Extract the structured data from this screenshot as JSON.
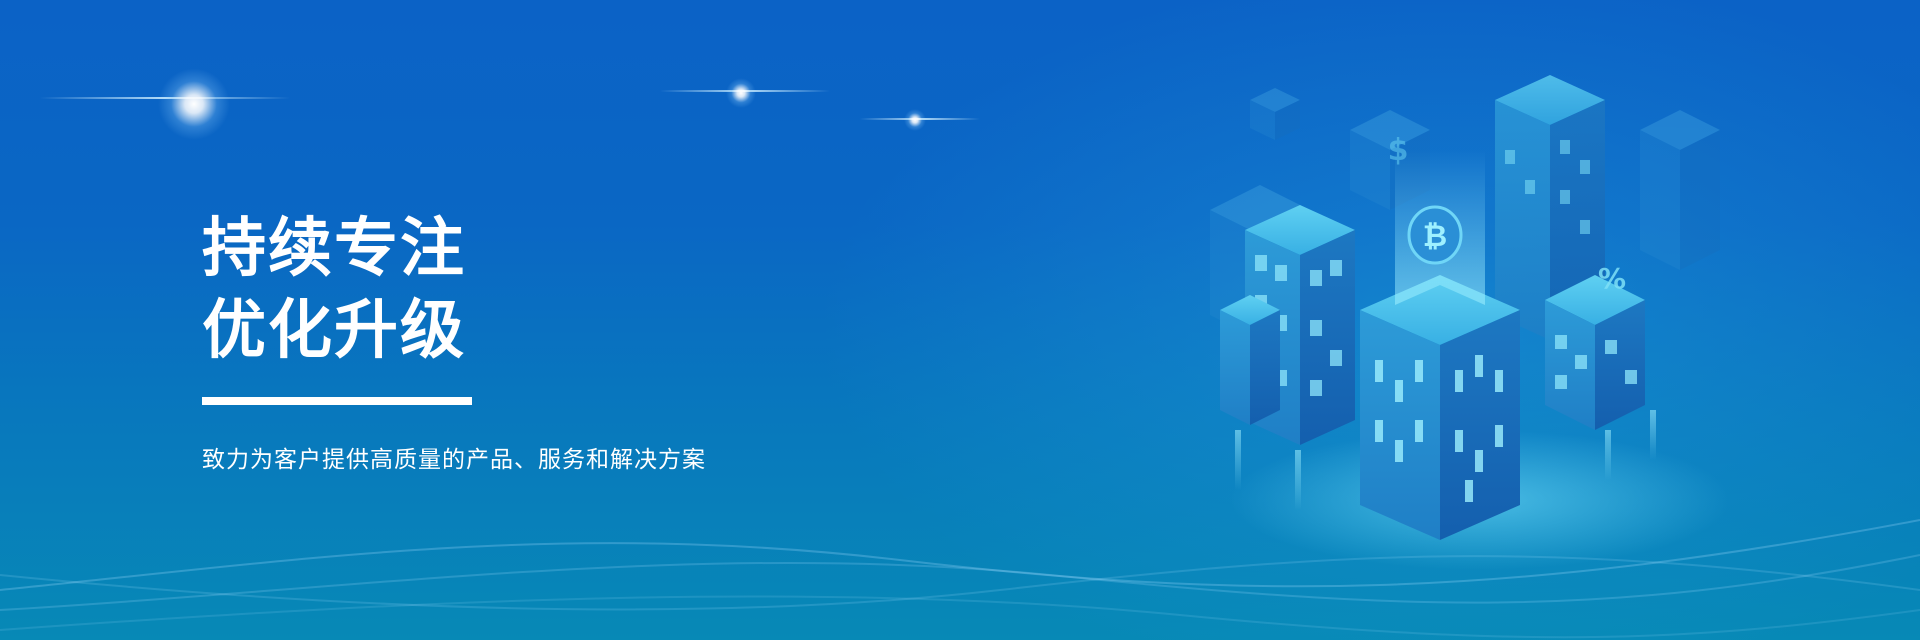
{
  "banner": {
    "headline_line1": "持续专注",
    "headline_line2": "优化升级",
    "subtitle": "致力为客户提供高质量的产品、服务和解决方案"
  },
  "illustration": {
    "icons": [
      "bitcoin-icon",
      "dollar-icon",
      "percent-icon"
    ]
  },
  "colors": {
    "background_top": "#0b62c6",
    "background_bottom": "#0789b6",
    "text": "#ffffff",
    "building_light": "#3fb7e6",
    "building_dark": "#1a6fb8"
  }
}
